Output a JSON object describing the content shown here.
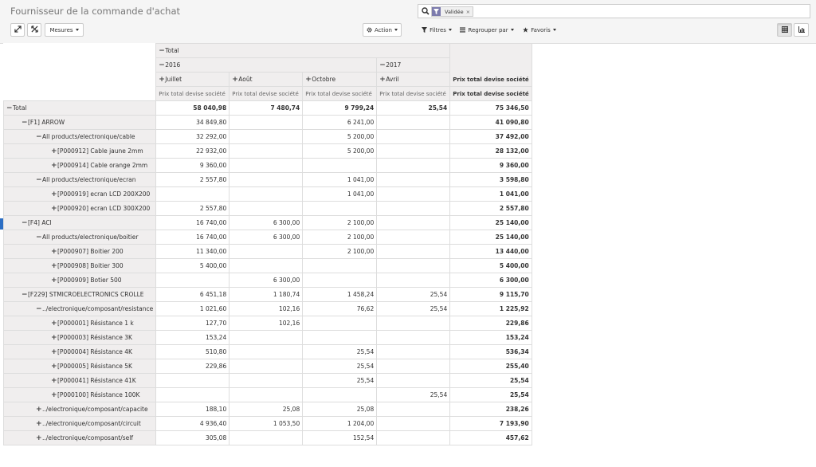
{
  "title": "Fournisseur de la commande d'achat",
  "search": {
    "facet_label": "Validée",
    "facet_remove": "×"
  },
  "toolbar": {
    "measures": "Mesures",
    "action": "Action",
    "filters": "Filtres",
    "groupby": "Regrouper par",
    "favorites": "Favoris"
  },
  "headers": {
    "total": "Total",
    "y2016": "2016",
    "y2017": "2017",
    "m_juillet": "Juillet",
    "m_aout": "Août",
    "m_octobre": "Octobre",
    "m_avril": "Avril",
    "measure": "Prix total devise société",
    "total_col": "Prix total devise société"
  },
  "rows": [
    {
      "label": "Total",
      "depth": 0,
      "sign": "−",
      "juillet": "58 040,98",
      "aout": "7 480,74",
      "octobre": "9 799,24",
      "avril": "25,54",
      "total": "75 346,50"
    },
    {
      "label": "[F1] ARROW",
      "depth": 1,
      "sign": "−",
      "juillet": "34 849,80",
      "aout": "",
      "octobre": "6 241,00",
      "avril": "",
      "total": "41 090,80"
    },
    {
      "label": "All products/electronique/cable",
      "depth": 2,
      "sign": "−",
      "juillet": "32 292,00",
      "aout": "",
      "octobre": "5 200,00",
      "avril": "",
      "total": "37 492,00"
    },
    {
      "label": "[P000912] Cable jaune 2mm",
      "depth": 3,
      "sign": "+",
      "juillet": "22 932,00",
      "aout": "",
      "octobre": "5 200,00",
      "avril": "",
      "total": "28 132,00"
    },
    {
      "label": "[P000914] Cable orange 2mm",
      "depth": 3,
      "sign": "+",
      "juillet": "9 360,00",
      "aout": "",
      "octobre": "",
      "avril": "",
      "total": "9 360,00"
    },
    {
      "label": "All products/electronique/ecran",
      "depth": 2,
      "sign": "−",
      "juillet": "2 557,80",
      "aout": "",
      "octobre": "1 041,00",
      "avril": "",
      "total": "3 598,80"
    },
    {
      "label": "[P000919] ecran LCD 200X200",
      "depth": 3,
      "sign": "+",
      "juillet": "",
      "aout": "",
      "octobre": "1 041,00",
      "avril": "",
      "total": "1 041,00"
    },
    {
      "label": "[P000920] ecran LCD 300X200",
      "depth": 3,
      "sign": "+",
      "juillet": "2 557,80",
      "aout": "",
      "octobre": "",
      "avril": "",
      "total": "2 557,80"
    },
    {
      "label": "[F4] ACI",
      "depth": 1,
      "sign": "−",
      "juillet": "16 740,00",
      "aout": "6 300,00",
      "octobre": "2 100,00",
      "avril": "",
      "total": "25 140,00"
    },
    {
      "label": "All products/electronique/boitier",
      "depth": 2,
      "sign": "−",
      "juillet": "16 740,00",
      "aout": "6 300,00",
      "octobre": "2 100,00",
      "avril": "",
      "total": "25 140,00"
    },
    {
      "label": "[P000907] Boitier 200",
      "depth": 3,
      "sign": "+",
      "juillet": "11 340,00",
      "aout": "",
      "octobre": "2 100,00",
      "avril": "",
      "total": "13 440,00"
    },
    {
      "label": "[P000908] Boitier 300",
      "depth": 3,
      "sign": "+",
      "juillet": "5 400,00",
      "aout": "",
      "octobre": "",
      "avril": "",
      "total": "5 400,00"
    },
    {
      "label": "[P000909] Botier 500",
      "depth": 3,
      "sign": "+",
      "juillet": "",
      "aout": "6 300,00",
      "octobre": "",
      "avril": "",
      "total": "6 300,00"
    },
    {
      "label": "[F229] STMICROELECTRONICS CROLLE",
      "depth": 1,
      "sign": "−",
      "juillet": "6 451,18",
      "aout": "1 180,74",
      "octobre": "1 458,24",
      "avril": "25,54",
      "total": "9 115,70"
    },
    {
      "label": "../electronique/composant/resistance",
      "depth": 2,
      "sign": "−",
      "juillet": "1 021,60",
      "aout": "102,16",
      "octobre": "76,62",
      "avril": "25,54",
      "total": "1 225,92"
    },
    {
      "label": "[P000001] Résistance 1 k",
      "depth": 3,
      "sign": "+",
      "juillet": "127,70",
      "aout": "102,16",
      "octobre": "",
      "avril": "",
      "total": "229,86"
    },
    {
      "label": "[P000003] Résistance 3K",
      "depth": 3,
      "sign": "+",
      "juillet": "153,24",
      "aout": "",
      "octobre": "",
      "avril": "",
      "total": "153,24"
    },
    {
      "label": "[P000004] Résistance 4K",
      "depth": 3,
      "sign": "+",
      "juillet": "510,80",
      "aout": "",
      "octobre": "25,54",
      "avril": "",
      "total": "536,34"
    },
    {
      "label": "[P000005] Résistance 5K",
      "depth": 3,
      "sign": "+",
      "juillet": "229,86",
      "aout": "",
      "octobre": "25,54",
      "avril": "",
      "total": "255,40"
    },
    {
      "label": "[P000041] Résistance 41K",
      "depth": 3,
      "sign": "+",
      "juillet": "",
      "aout": "",
      "octobre": "25,54",
      "avril": "",
      "total": "25,54"
    },
    {
      "label": "[P000100] Résistance 100K",
      "depth": 3,
      "sign": "+",
      "juillet": "",
      "aout": "",
      "octobre": "",
      "avril": "25,54",
      "total": "25,54"
    },
    {
      "label": "../electronique/composant/capacite",
      "depth": 2,
      "sign": "+",
      "juillet": "188,10",
      "aout": "25,08",
      "octobre": "25,08",
      "avril": "",
      "total": "238,26"
    },
    {
      "label": "../electronique/composant/circuit",
      "depth": 2,
      "sign": "+",
      "juillet": "4 936,40",
      "aout": "1 053,50",
      "octobre": "1 204,00",
      "avril": "",
      "total": "7 193,90"
    },
    {
      "label": "../electronique/composant/self",
      "depth": 2,
      "sign": "+",
      "juillet": "305,08",
      "aout": "",
      "octobre": "152,54",
      "avril": "",
      "total": "457,62"
    }
  ]
}
